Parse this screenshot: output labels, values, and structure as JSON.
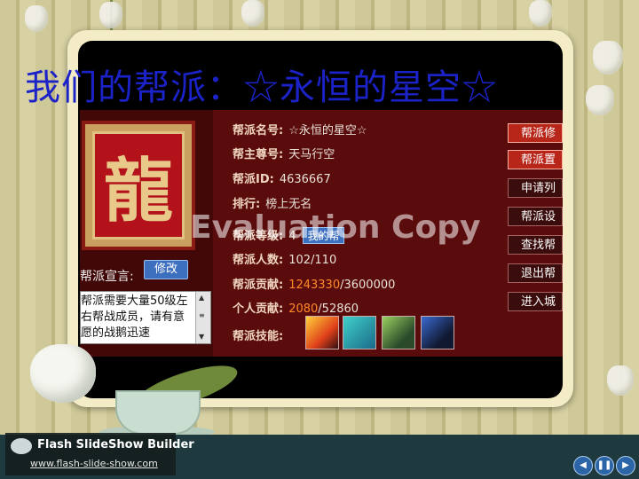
{
  "slide": {
    "title": "我们的帮派：☆永恒的星空☆",
    "watermark": "Evaluation Copy"
  },
  "guild": {
    "emblem_char": "龍",
    "declaration_label": "帮派宣言:",
    "edit_button": "修改",
    "declaration_text": "帮派需要大量50级左右帮战成员，请有意愿的战鹅迅速",
    "rows": [
      {
        "label": "帮派名号:",
        "value": "☆永恒的星空☆"
      },
      {
        "label": "帮主尊号:",
        "value": "天马行空"
      },
      {
        "label": "帮派ID:",
        "value": "4636667"
      },
      {
        "label": "排行:",
        "value": "榜上无名"
      },
      {
        "label": "帮派等级:",
        "value": "4",
        "button": "我的帮"
      },
      {
        "label": "帮派人数:",
        "value": "102/110"
      }
    ],
    "contribution": {
      "label": "帮派贡献:",
      "current": "1243330",
      "total": "/3600000"
    },
    "personal": {
      "label": "个人贡献:",
      "current": "2080",
      "total": "/52860"
    },
    "skills_label": "帮派技能:",
    "skill_icons": [
      "fire-skill-icon",
      "music-skill-icon",
      "wind-skill-icon",
      "bird-skill-icon"
    ]
  },
  "right_buttons": [
    {
      "label": "帮派修",
      "style": "red"
    },
    {
      "label": "帮派置",
      "style": "red"
    },
    {
      "label": "申请列",
      "style": "dark"
    },
    {
      "label": "帮派设",
      "style": "dark"
    },
    {
      "label": "查找帮",
      "style": "dark"
    },
    {
      "label": "退出帮",
      "style": "dark"
    },
    {
      "label": "进入城",
      "style": "dark"
    }
  ],
  "player": {
    "brand": "Flash SlideShow Builder",
    "url": "www.flash-slide-show.com",
    "controls": [
      "prev-icon",
      "pause-icon",
      "next-icon"
    ]
  },
  "colors": {
    "title": "#1b23c8",
    "panel": "#5a0b0b",
    "highlight": "#ff8a2a"
  }
}
